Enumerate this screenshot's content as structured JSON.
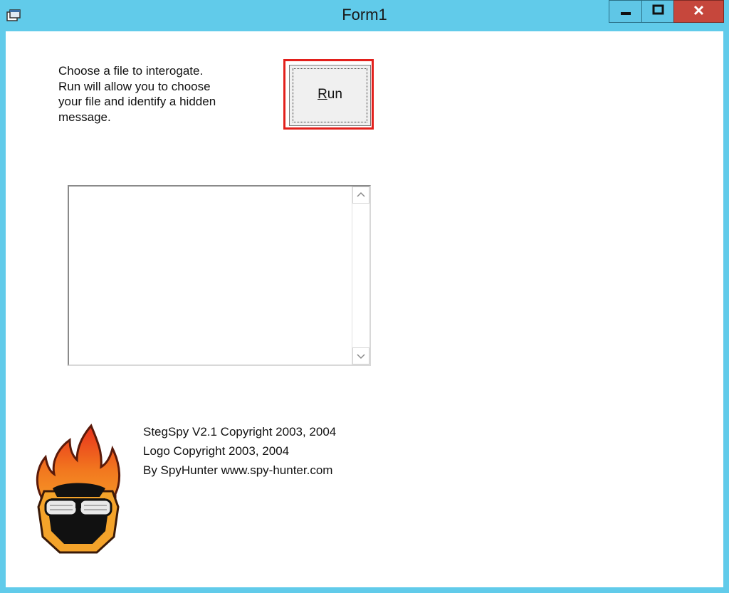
{
  "window": {
    "title": "Form1",
    "app_icon": "form-icon",
    "minimize": "minimize-icon",
    "maximize": "maximize-icon",
    "close": "close-icon"
  },
  "form": {
    "description": "Choose a file to interogate.\nRun will allow you to choose\nyour file and identify a hidden\nmessage.",
    "run_button": {
      "underlined": "R",
      "rest": "un"
    },
    "output_text": ""
  },
  "credits": {
    "line1": "StegSpy V2.1 Copyright 2003, 2004",
    "line2": "Logo Copyright 2003, 2004",
    "line3": "By SpyHunter www.spy-hunter.com"
  },
  "colors": {
    "title_bar": "#61cbea",
    "close_button": "#c6473c",
    "focus_outline": "#e2201c"
  },
  "icons": [
    "form-icon",
    "minimize-icon",
    "maximize-icon",
    "close-icon",
    "scroll-up-icon",
    "scroll-down-icon",
    "spyhunter-logo"
  ]
}
